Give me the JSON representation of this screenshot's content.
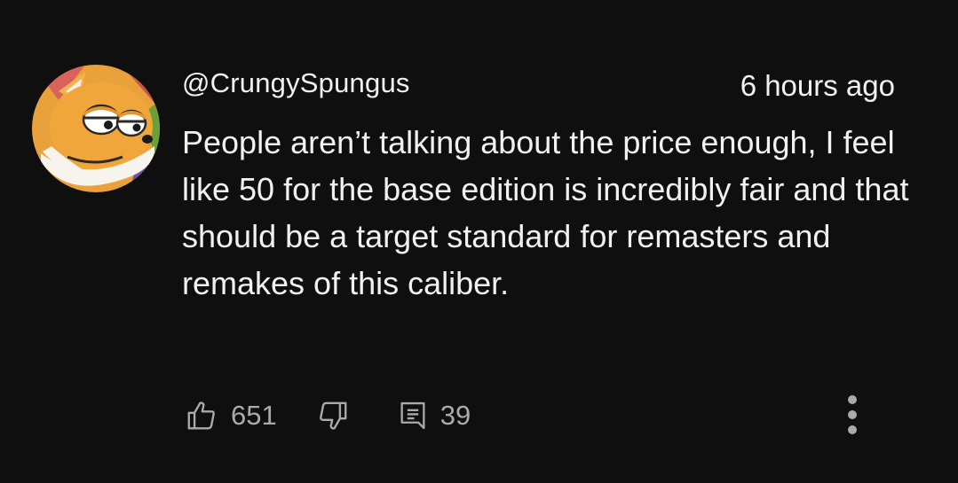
{
  "comment": {
    "username": "@CrungySpungus",
    "timestamp": "6 hours ago",
    "text": "People aren’t talking about the price enough, I feel like 50 for the base edition is incredibly fair and that should be a target standard for remasters and remakes of this caliber.",
    "avatar_description_icon": "fox-character-avatar"
  },
  "actions": {
    "like_icon": "thumbs-up-icon",
    "like_count": "651",
    "dislike_icon": "thumbs-down-icon",
    "reply_icon": "reply-icon",
    "reply_count": "39",
    "more_icon": "more-vertical-icon"
  },
  "colors": {
    "background": "#0f0f0f",
    "primary_text": "#f1f1f1",
    "secondary_text": "#aaaaaa"
  }
}
